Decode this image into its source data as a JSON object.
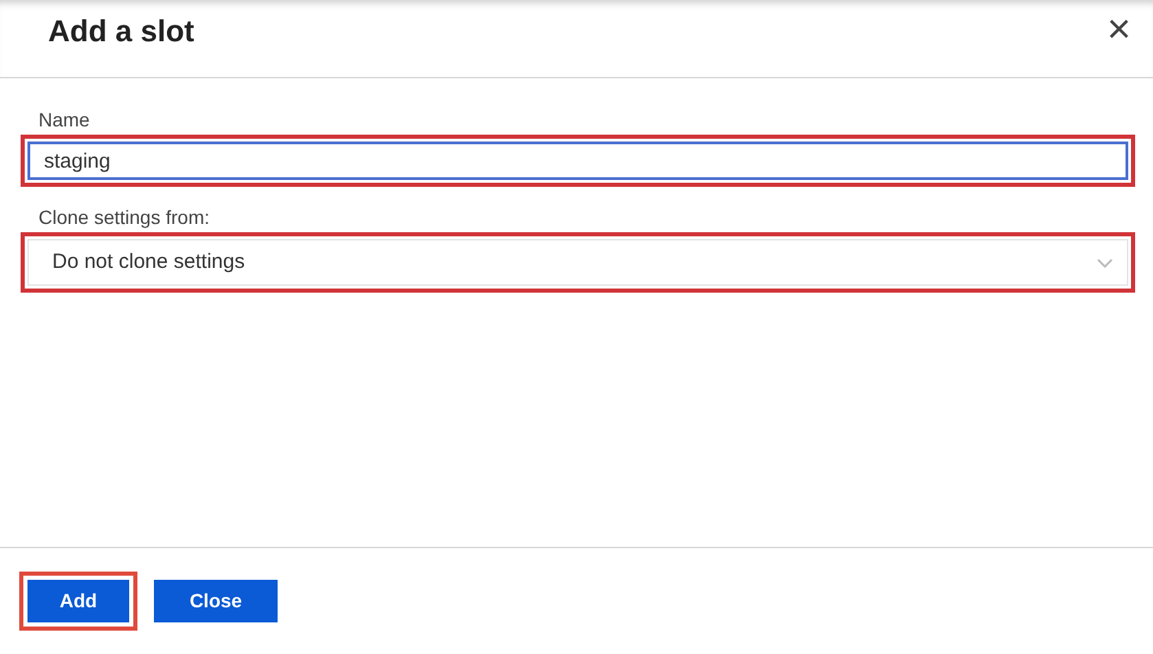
{
  "dialog": {
    "title": "Add a slot",
    "close_glyph": "×"
  },
  "fields": [
    {
      "kind": "text",
      "label": "Name",
      "value": "staging",
      "focused": true,
      "highlighted": true
    },
    {
      "kind": "select",
      "label": "Clone settings from:",
      "value": "Do not clone settings",
      "focused": false,
      "highlighted": true
    }
  ],
  "buttons": [
    {
      "label": "Add",
      "highlighted": true
    },
    {
      "label": "Close",
      "highlighted": false
    }
  ]
}
